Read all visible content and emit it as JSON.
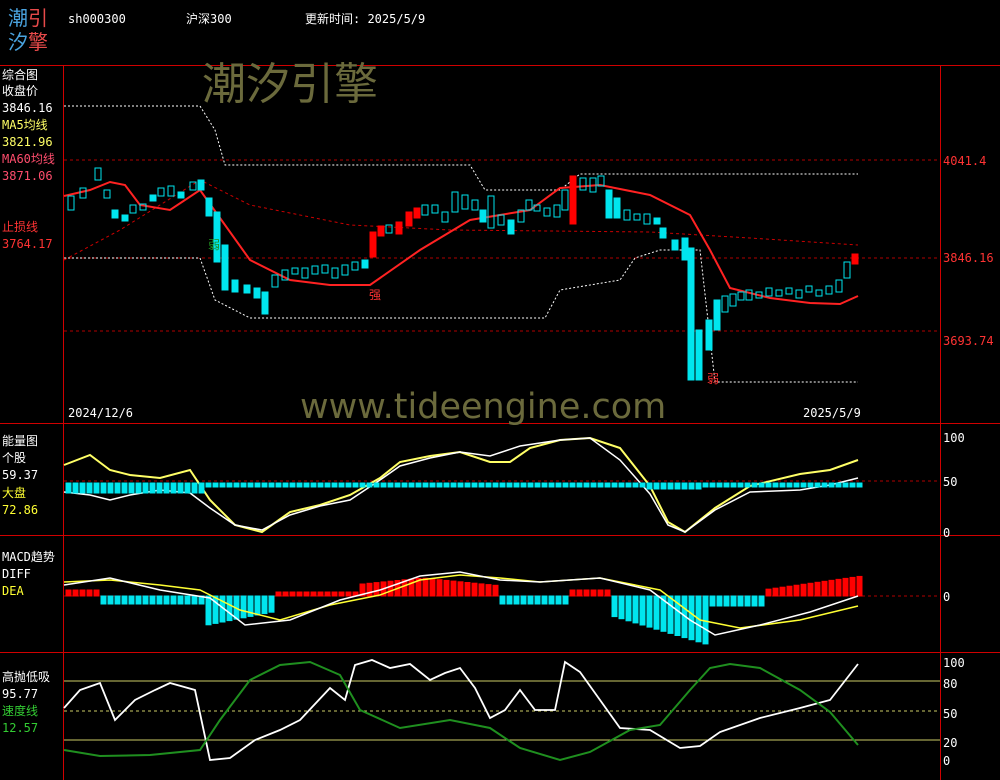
{
  "header": {
    "logo_line1": "潮引",
    "logo_line2": "汐擎",
    "symbol": "sh000300",
    "name": "沪深300",
    "update_label": "更新时间: 2025/5/9"
  },
  "watermark": {
    "brand": "潮汐引擎",
    "url": "www.tideengine.com"
  },
  "colors": {
    "grid": "#d00000",
    "up": "#ff0000",
    "down": "#00e5ee",
    "ma5": "#ffff66",
    "ma60": "#ff4d6d",
    "stop": "#ff3333",
    "macd_diff": "#ffffff",
    "macd_dea": "#ffff33",
    "speed": "#1f8f1f"
  },
  "main_panel": {
    "title": "综合图",
    "close_label": "收盘价",
    "close_value": "3846.16",
    "ma5_label": "MA5均线",
    "ma5_value": "3821.96",
    "ma60_label": "MA60均线",
    "ma60_value": "3871.06",
    "stop_label": "止损线",
    "stop_value": "3764.17",
    "axis": [
      "4041.4",
      "3846.16",
      "3693.74"
    ],
    "date_start": "2024/12/6",
    "date_end": "2025/5/9",
    "marks": [
      "弱",
      "强",
      "弱"
    ]
  },
  "energy_panel": {
    "title": "能量图",
    "stock_label": "个股",
    "stock_value": "59.37",
    "market_label": "大盘",
    "market_value": "72.86",
    "axis": [
      "100",
      "50",
      "0"
    ]
  },
  "macd_panel": {
    "title": "MACD趋势",
    "diff_label": "DIFF",
    "dea_label": "DEA",
    "axis": [
      "0"
    ]
  },
  "bottom_panel": {
    "title": "高抛低吸",
    "value": "95.77",
    "speed_label": "速度线",
    "speed_value": "12.57",
    "axis": [
      "100",
      "80",
      "50",
      "20",
      "0"
    ]
  }
}
